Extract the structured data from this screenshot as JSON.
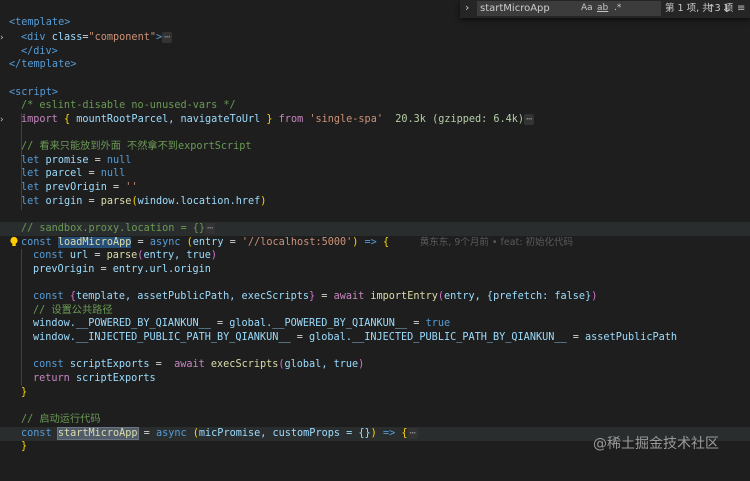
{
  "find_widget": {
    "query": "startMicroApp",
    "match_case_label": "Aa",
    "whole_word_label": "ab",
    "regex_label": ".*",
    "result_count": "第 1 项, 共 3 项",
    "prev_label": "↑",
    "next_label": "↓",
    "selection_label": "≡",
    "close_label": "✕",
    "toggle_label": "›"
  },
  "code": {
    "l1": "<template>",
    "l2_div_open": "<div",
    "l2_attr": "class",
    "l2_eq": "=",
    "l2_val": "\"component\"",
    "l2_close": ">",
    "fold_ellipsis": "⋯",
    "l3": "</div>",
    "l4": "</template>",
    "l6": "<script>",
    "l7": "/* eslint-disable no-unused-vars */",
    "l8_import": "import",
    "l8_names": "mountRootParcel, navigateToUrl",
    "l8_from": "from",
    "l8_mod": "'single-spa'",
    "l8_size": "20.3k",
    "l8_gz": "(gzipped: 6.4k)",
    "l10": "// 看来只能放到外面 不然拿不到exportScript",
    "l11_kw": "let",
    "l11_var": "promise",
    "l11_val": "null",
    "l12_kw": "let",
    "l12_var": "parcel",
    "l12_val": "null",
    "l13_kw": "let",
    "l13_var": "prevOrigin",
    "l13_val": "''",
    "l14_kw": "let",
    "l14_var": "origin",
    "l14_fn": "parse",
    "l14_arg": "window.location.href",
    "l16": "// sandbox.proxy.location = {}",
    "l17_kw": "const",
    "l17_name": "loadMicroApp",
    "l17_async": "async",
    "l17_param": "entry",
    "l17_default": "'//localhost:5000'",
    "l17_blame": "黄东东, 9个月前 • feat: 初始化代码",
    "l18_kw": "const",
    "l18_var": "url",
    "l18_fn": "parse",
    "l18_args": "entry, true",
    "l19_var": "prevOrigin",
    "l19_rhs": "entry.url.origin",
    "l21_kw": "const",
    "l21_destr": "template, assetPublicPath, execScripts",
    "l21_await": "await",
    "l21_fn": "importEntry",
    "l21_args": "entry, {prefetch: false}",
    "l22": "// 设置公共路径",
    "l23_lhs": "window.__POWERED_BY_QIANKUN__",
    "l23_rhs": "global.__POWERED_BY_QIANKUN__",
    "l23_val": "true",
    "l24_lhs": "window.__INJECTED_PUBLIC_PATH_BY_QIANKUN__",
    "l24_mid": "global.__INJECTED_PUBLIC_PATH_BY_QIANKUN__",
    "l24_val": "assetPublicPath",
    "l26_kw": "const",
    "l26_var": "scriptExports",
    "l26_await": "await",
    "l26_fn": "execScripts",
    "l26_args": "global, true",
    "l27_kw": "return",
    "l27_var": "scriptExports",
    "l28": "}",
    "l30": "// 启动运行代码",
    "l31_kw": "const",
    "l31_name": "startMicroApp",
    "l31_async": "async",
    "l31_params": "micPromise, customProps = {}",
    "l32": "}"
  },
  "watermark": "@稀土掘金技术社区"
}
